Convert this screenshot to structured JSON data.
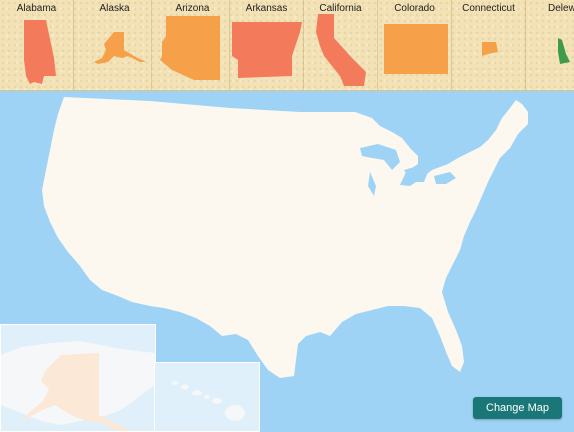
{
  "tray": {
    "states": [
      {
        "label": "Alabama",
        "color": "#f47a5c"
      },
      {
        "label": "Alaska",
        "color": "#f7a04a"
      },
      {
        "label": "Arizona",
        "color": "#f7a04a"
      },
      {
        "label": "Arkansas",
        "color": "#f47a5c"
      },
      {
        "label": "California",
        "color": "#f47a5c"
      },
      {
        "label": "Colorado",
        "color": "#f7a04a"
      },
      {
        "label": "Connecticut",
        "color": "#f7a04a"
      },
      {
        "label": "Delew",
        "color": "#3f9a4a"
      }
    ]
  },
  "map": {
    "land_color": "#fcf8f0",
    "ocean_color": "#9fd3f5",
    "alaska_highlight": "#fbe8d6"
  },
  "controls": {
    "change_map_label": "Change Map"
  }
}
